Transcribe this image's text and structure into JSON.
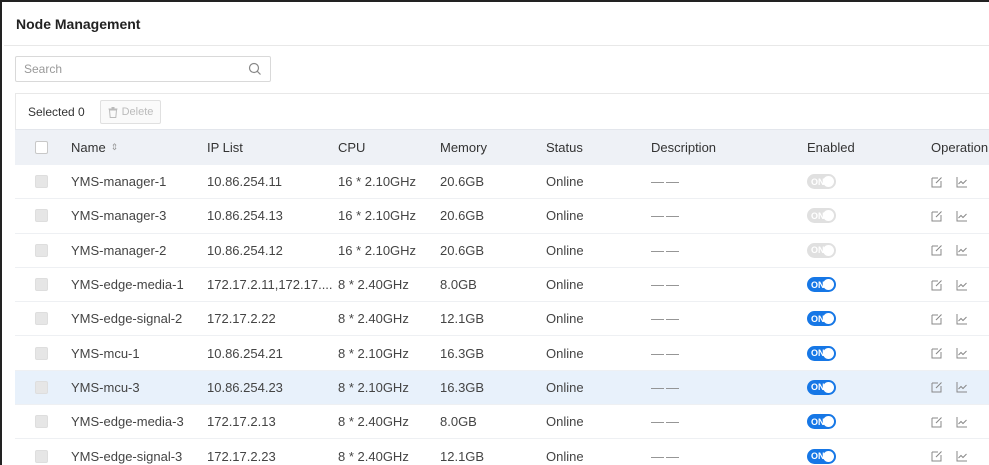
{
  "header": {
    "title": "Node Management"
  },
  "search": {
    "placeholder": "Search",
    "value": ""
  },
  "toolbar": {
    "selected_label": "Selected 0",
    "delete_label": "Delete"
  },
  "table": {
    "columns": [
      "Name",
      "IP List",
      "CPU",
      "Memory",
      "Status",
      "Description",
      "Enabled",
      "Operation"
    ],
    "rows": [
      {
        "name": "YMS-manager-1",
        "ip": "10.86.254.11",
        "cpu": "16 * 2.10GHz",
        "memory": "20.6GB",
        "status": "Online",
        "description": "——",
        "enabled": "ON",
        "enabled_state": "disabled"
      },
      {
        "name": "YMS-manager-3",
        "ip": "10.86.254.13",
        "cpu": "16 * 2.10GHz",
        "memory": "20.6GB",
        "status": "Online",
        "description": "——",
        "enabled": "ON",
        "enabled_state": "disabled"
      },
      {
        "name": "YMS-manager-2",
        "ip": "10.86.254.12",
        "cpu": "16 * 2.10GHz",
        "memory": "20.6GB",
        "status": "Online",
        "description": "——",
        "enabled": "ON",
        "enabled_state": "disabled"
      },
      {
        "name": "YMS-edge-media-1",
        "ip": "172.17.2.11,172.17....",
        "cpu": "8 * 2.40GHz",
        "memory": "8.0GB",
        "status": "Online",
        "description": "——",
        "enabled": "ON",
        "enabled_state": "on"
      },
      {
        "name": "YMS-edge-signal-2",
        "ip": "172.17.2.22",
        "cpu": "8 * 2.40GHz",
        "memory": "12.1GB",
        "status": "Online",
        "description": "——",
        "enabled": "ON",
        "enabled_state": "on"
      },
      {
        "name": "YMS-mcu-1",
        "ip": "10.86.254.21",
        "cpu": "8 * 2.10GHz",
        "memory": "16.3GB",
        "status": "Online",
        "description": "——",
        "enabled": "ON",
        "enabled_state": "on"
      },
      {
        "name": "YMS-mcu-3",
        "ip": "10.86.254.23",
        "cpu": "8 * 2.10GHz",
        "memory": "16.3GB",
        "status": "Online",
        "description": "——",
        "enabled": "ON",
        "enabled_state": "on"
      },
      {
        "name": "YMS-edge-media-3",
        "ip": "172.17.2.13",
        "cpu": "8 * 2.40GHz",
        "memory": "8.0GB",
        "status": "Online",
        "description": "——",
        "enabled": "ON",
        "enabled_state": "on"
      },
      {
        "name": "YMS-edge-signal-3",
        "ip": "172.17.2.23",
        "cpu": "8 * 2.40GHz",
        "memory": "12.1GB",
        "status": "Online",
        "description": "——",
        "enabled": "ON",
        "enabled_state": "on"
      }
    ],
    "highlighted_row": 6
  },
  "icons": {
    "search": "search-icon",
    "delete": "trash-icon",
    "sort": "sort-icon",
    "edit": "edit-icon",
    "monitor": "line-chart-icon"
  },
  "colors": {
    "accent": "#1677e6",
    "header_bg": "#eef1f6",
    "highlight_row": "#e8f1fb"
  }
}
